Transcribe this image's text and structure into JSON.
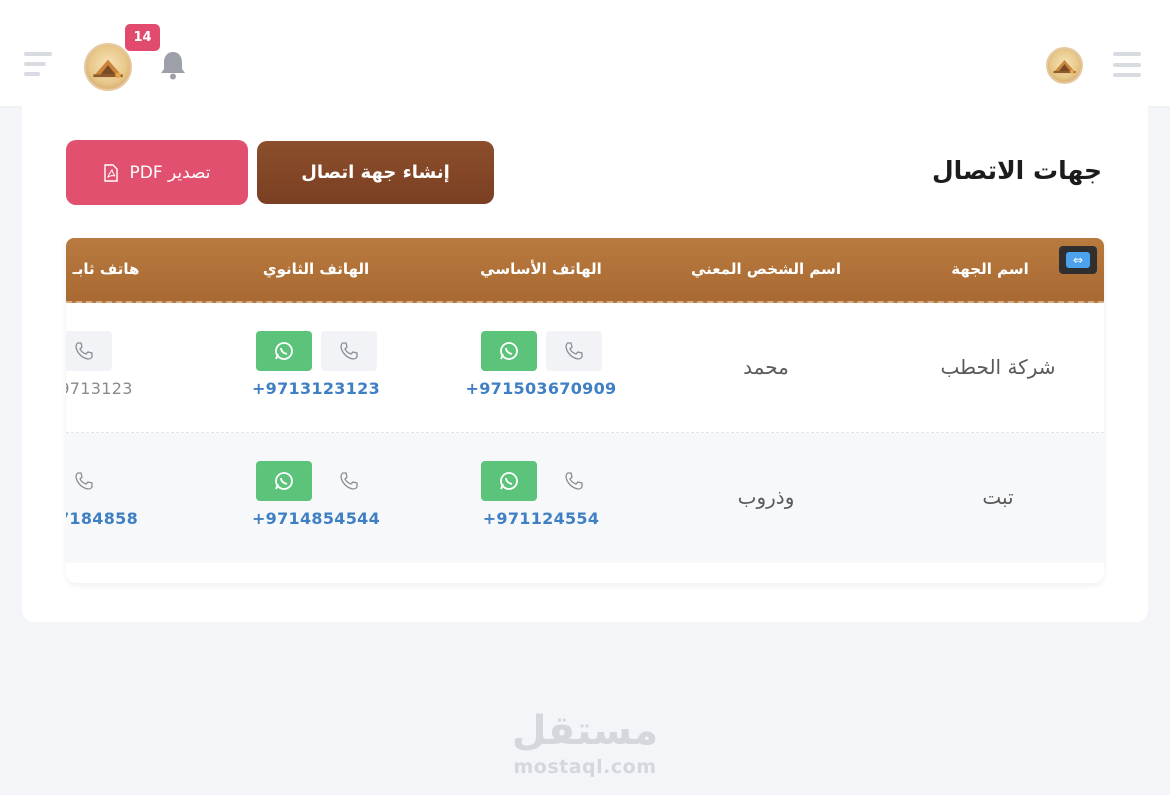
{
  "header": {
    "notifications_count": "14",
    "icons": {
      "menu_left": "hamburger-icon",
      "menu_right": "hamburger-icon",
      "bell": "bell-icon",
      "avatar": "logo-avatar"
    }
  },
  "page": {
    "title": "جهات الاتصال",
    "create_button": "إنشاء جهة اتصال",
    "export_button": "تصدير PDF"
  },
  "table": {
    "headers": {
      "entity_name": "اسم الجهة",
      "contact_person": "اسم الشخص المعني",
      "primary_phone": "الهاتف الأساسي",
      "secondary_phone": "الهاتف الثانوي",
      "other_phone": "هاتف ثابـ"
    },
    "rows": [
      {
        "entity_name": "شركة الحطب",
        "contact_person": "محمد",
        "primary_phone": "+971503670909",
        "secondary_phone": "+9713123123",
        "other_phone": "9713123"
      },
      {
        "entity_name": "تبت",
        "contact_person": "وذروب",
        "primary_phone": "+971124554",
        "secondary_phone": "+9714854544",
        "other_phone": "7184858"
      }
    ]
  },
  "colors": {
    "header_gradient": "#b87a3e",
    "create_button": "#7a3f22",
    "export_button": "#e2506f",
    "whatsapp": "#5cc47a",
    "phone_link": "#3f7fc4",
    "badge": "#e04b6e"
  },
  "watermark": {
    "arabic": "مستقل",
    "latin": "mostaql.com"
  }
}
